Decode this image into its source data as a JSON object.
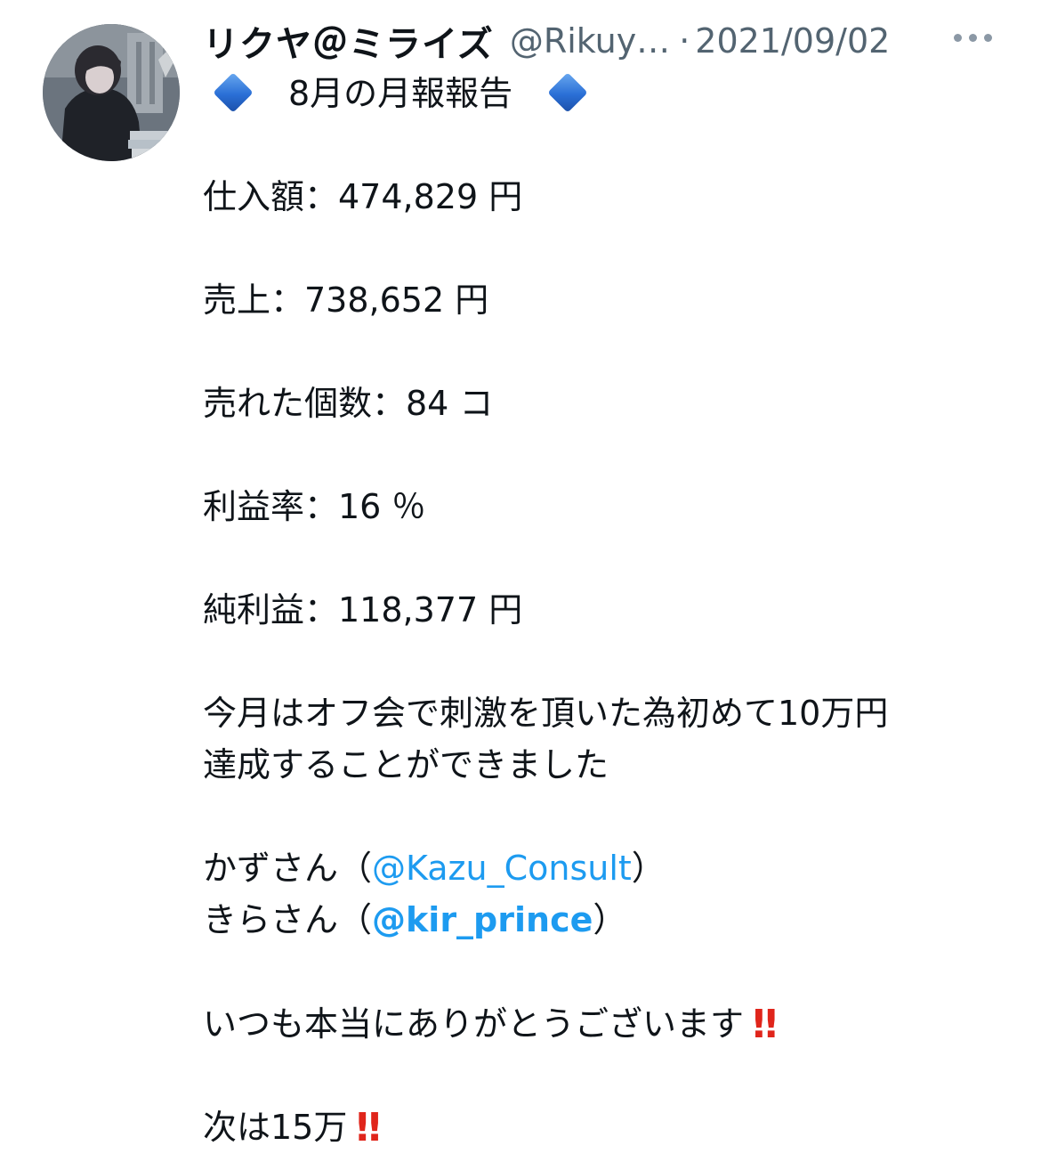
{
  "tweet": {
    "display_name": "リクヤ＠ミライズ",
    "handle": "@Rikuy…",
    "separator": "·",
    "date": "2021/09/02"
  },
  "icons": {
    "avatar": "avatar-illustration",
    "more": "more-options-icon",
    "diamond": "large-blue-diamond-emoji",
    "double_exclamation": "double-exclamation-emoji"
  },
  "colors": {
    "text": "#0f1419",
    "secondary": "#536471",
    "link": "#1d9bf0",
    "emoji_red": "#e0251b",
    "emoji_blue": "#2a6fd6"
  },
  "content": {
    "title": "8月の月報報告",
    "purchase": "仕入額：474,829 円",
    "sales": "売上：738,652 円",
    "units": "売れた個数：84 コ",
    "margin": "利益率：16 ％",
    "profit": "純利益：118,377 円",
    "message_line1": "今月はオフ会で刺激を頂いた為初めて10万円",
    "message_line2": "達成することができました",
    "thanks1_prefix": "かずさん（",
    "thanks1_mention": "@Kazu_Consult",
    "thanks1_suffix": "）",
    "thanks2_prefix": "きらさん（",
    "thanks2_mention": "@kir_prince",
    "thanks2_suffix": "）",
    "gratitude": "いつも本当にありがとうございます",
    "next_goal": "次は15万",
    "bangbang": "‼"
  }
}
